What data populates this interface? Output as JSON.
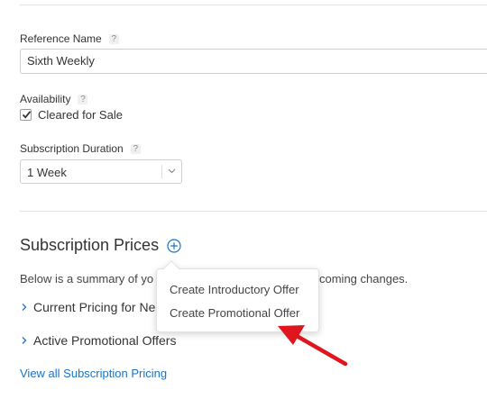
{
  "reference_name": {
    "label": "Reference Name",
    "help": "?",
    "value": "Sixth Weekly"
  },
  "availability": {
    "label": "Availability",
    "help": "?",
    "checkbox_label": "Cleared for Sale",
    "checked": true
  },
  "duration": {
    "label": "Subscription Duration",
    "help": "?",
    "value": "1 Week"
  },
  "prices": {
    "title": "Subscription Prices",
    "summary_start": "Below is a summary of yo",
    "summary_end": "coming changes.",
    "row_current": "Current Pricing for Ne",
    "row_active": "Active Promotional Offers",
    "link": "View all Subscription Pricing"
  },
  "popover": {
    "items": [
      "Create Introductory Offer",
      "Create Promotional Offer"
    ]
  },
  "colors": {
    "link": "#1a73c9",
    "arrow": "#e0161e"
  }
}
